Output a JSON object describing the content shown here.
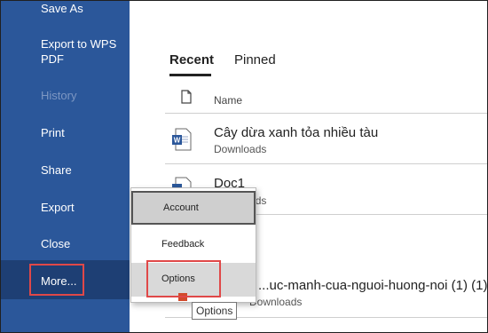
{
  "sidebar": {
    "items": [
      {
        "label": "Save As"
      },
      {
        "label": "Export to WPS PDF"
      },
      {
        "label": "History"
      },
      {
        "label": "Print"
      },
      {
        "label": "Share"
      },
      {
        "label": "Export"
      },
      {
        "label": "Close"
      },
      {
        "label": "More..."
      }
    ]
  },
  "main": {
    "tabs": [
      {
        "label": "Recent"
      },
      {
        "label": "Pinned"
      }
    ],
    "column_header": "Name",
    "files": [
      {
        "title": "Cây dừa xanh tỏa nhiều tàu",
        "location": "Downloads"
      },
      {
        "title": "Doc1",
        "location": "Downloads"
      },
      {
        "title": "...uc-manh-cua-nguoi-huong-noi (1) (1)",
        "location": "Downloads"
      }
    ]
  },
  "popup_menu": {
    "items": [
      {
        "label": "Account"
      },
      {
        "label": "Feedback"
      },
      {
        "label": "Options"
      }
    ]
  },
  "tooltip": {
    "text": "Options"
  },
  "colors": {
    "sidebar": "#2b579a",
    "highlight": "#e04848",
    "word_blue": "#2b579a"
  }
}
